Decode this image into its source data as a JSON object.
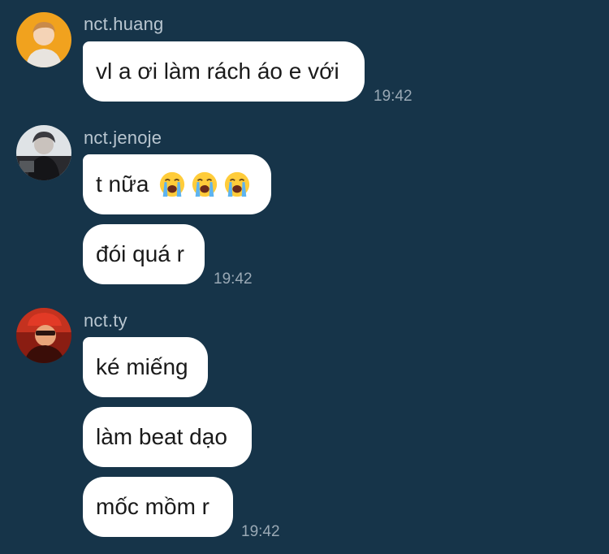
{
  "messages": [
    {
      "username": "nct.huang",
      "bubbles": [
        "vl a ơi làm rách áo e với"
      ],
      "time": "19:42"
    },
    {
      "username": "nct.jenoje",
      "bubbles": [
        "t nữa",
        "đói quá r"
      ],
      "emoji": "loudly-crying-face",
      "time": "19:42"
    },
    {
      "username": "nct.ty",
      "bubbles": [
        "ké miếng",
        "làm beat dạo",
        "mốc mồm r"
      ],
      "time": "19:42"
    }
  ],
  "colors": {
    "background": "#163449",
    "bubble": "#ffffff",
    "username": "#b9c6d0",
    "timestamp": "#9aa9b5"
  }
}
